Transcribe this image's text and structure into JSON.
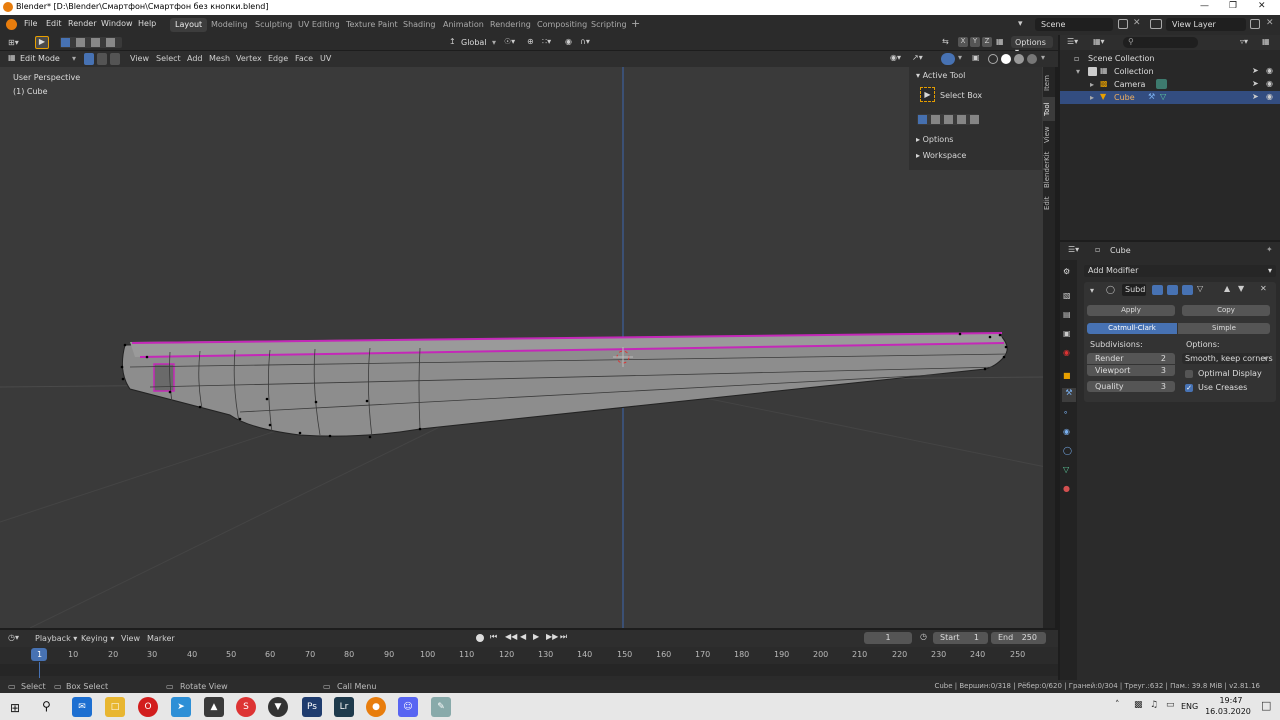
{
  "window": {
    "title": "Blender* [D:\\Blender\\Смартфон\\Смартфон без кнопки.blend]"
  },
  "menus": [
    "File",
    "Edit",
    "Render",
    "Window",
    "Help"
  ],
  "workspaces": [
    "Layout",
    "Modeling",
    "Sculpting",
    "UV Editing",
    "Texture Paint",
    "Shading",
    "Animation",
    "Rendering",
    "Compositing",
    "Scripting"
  ],
  "active_workspace": "Layout",
  "scene": {
    "label": "Scene",
    "view_layer": "View Layer"
  },
  "header": {
    "orientation": "Global",
    "options": "Options"
  },
  "viewport_bar": {
    "mode": "Edit Mode",
    "menus": [
      "View",
      "Select",
      "Add",
      "Mesh",
      "Vertex",
      "Edge",
      "Face",
      "UV"
    ]
  },
  "viewport": {
    "perspective": "User Perspective",
    "object": "(1) Cube"
  },
  "npanel": {
    "active_tool_label": "Active Tool",
    "tool_name": "Select Box",
    "options_label": "Options",
    "workspace_label": "Workspace",
    "tabs": [
      "Item",
      "Tool",
      "View",
      "BlenderKit",
      "Edit"
    ],
    "active_tab": "Tool"
  },
  "outliner": {
    "root": "Scene Collection",
    "items": [
      {
        "name": "Collection",
        "selected": false
      },
      {
        "name": "Camera",
        "selected": false
      },
      {
        "name": "Cube",
        "selected": true
      }
    ]
  },
  "properties": {
    "object_name": "Cube",
    "add_modifier": "Add Modifier",
    "modifier_name": "Subd",
    "apply": "Apply",
    "copy": "Copy",
    "catmull": "Catmull-Clark",
    "simple": "Simple",
    "subdivisions_label": "Subdivisions:",
    "options_label": "Options:",
    "render_label": "Render",
    "render_value": "2",
    "viewport_label": "Viewport",
    "viewport_value": "3",
    "quality_label": "Quality",
    "quality_value": "3",
    "uv_smooth": "Smooth, keep corners",
    "optimal_display": "Optimal Display",
    "optimal_display_checked": false,
    "use_creases": "Use Creases",
    "use_creases_checked": true
  },
  "timeline": {
    "playback": "Playback",
    "keying": "Keying",
    "view": "View",
    "marker": "Marker",
    "current_frame": "1",
    "start_label": "Start",
    "start": "1",
    "end_label": "End",
    "end": "250",
    "ruler": [
      "1",
      "10",
      "20",
      "30",
      "40",
      "50",
      "60",
      "70",
      "80",
      "90",
      "100",
      "110",
      "120",
      "130",
      "140",
      "150",
      "160",
      "170",
      "180",
      "190",
      "200",
      "210",
      "220",
      "230",
      "240",
      "250"
    ]
  },
  "status": {
    "select": "Select",
    "box_select": "Box Select",
    "rotate_view": "Rotate View",
    "call_menu": "Call Menu",
    "stats": "Cube | Вершин:0/318 | Рёбер:0/620 | Граней:0/304 | Треуг.:632 | Пам.: 39.8 MiB | v2.81.16"
  },
  "taskbar": {
    "lang": "ENG",
    "time": "19:47",
    "date": "16.03.2020"
  },
  "colors": {
    "accent": "#4772b3",
    "edge_select": "#c428b8",
    "viewport_bg": "#3a3a3a"
  }
}
